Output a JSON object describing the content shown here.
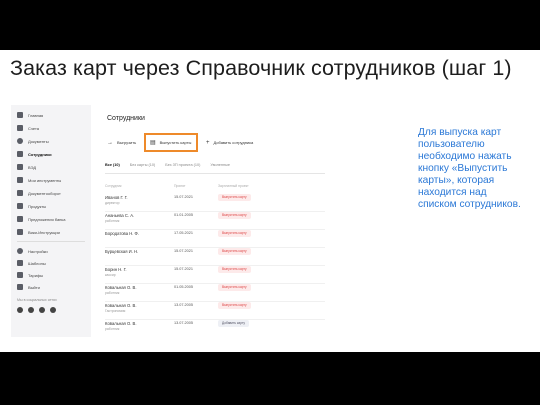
{
  "slide": {
    "title": "Заказ карт через Справочник сотрудников (шаг 1)",
    "note_lines": [
      "Для выпуска карт",
      "пользователю",
      "необходимо нажать",
      "кнопку «Выпустить",
      "карты», которая",
      "находится над",
      "списком сотрудников."
    ]
  },
  "app": {
    "sidebar": {
      "items": [
        {
          "label": "Главная",
          "icon": "home-icon"
        },
        {
          "label": "Счета",
          "icon": "wallet-icon"
        },
        {
          "label": "Документы",
          "icon": "document-icon"
        },
        {
          "label": "Сотрудники",
          "icon": "people-icon"
        },
        {
          "label": "ВЭД",
          "icon": "globe-icon"
        },
        {
          "label": "Мои инструменты",
          "icon": "tools-icon"
        },
        {
          "label": "Документооборот",
          "icon": "exchange-icon"
        },
        {
          "label": "Продукты",
          "icon": "box-icon"
        },
        {
          "label": "Предложения банка",
          "icon": "offer-icon"
        },
        {
          "label": "Вики-Инструкции",
          "icon": "book-icon"
        }
      ],
      "bottom_items": [
        {
          "label": "Настройки",
          "icon": "gear-icon"
        },
        {
          "label": "Шаблоны",
          "icon": "template-icon"
        },
        {
          "label": "Тарифы",
          "icon": "tariff-icon"
        },
        {
          "label": "Выйти",
          "icon": "logout-icon"
        }
      ],
      "social_label": "Мы в социальных сетях"
    },
    "main": {
      "title": "Сотрудники",
      "toolbar": {
        "upload_label": "Выгрузить",
        "issue_cards_label": "Выпустить карты",
        "add_employee_label": "Добавить сотрудника"
      },
      "tabs": [
        {
          "label": "Все (10)",
          "active": true
        },
        {
          "label": "Без карты (10)",
          "active": false
        },
        {
          "label": "Без ЗП проекта (10)",
          "active": false
        },
        {
          "label": "Уволенные",
          "active": false
        }
      ],
      "columns": [
        "Сотрудник",
        "Принят",
        "Зарплатный проект"
      ],
      "rows": [
        {
          "name": "Иванов Г. Г.",
          "role": "директор",
          "date": "15.07.2021",
          "status": "Выпустить карту",
          "status_kind": "red"
        },
        {
          "name": "Ананьева С. А.",
          "role": "работник",
          "date": "01.01.2005",
          "status": "Выпустить карту",
          "status_kind": "red"
        },
        {
          "name": "Бородатова Н. Ф.",
          "role": "",
          "date": "17.05.2021",
          "status": "Выпустить карту",
          "status_kind": "red"
        },
        {
          "name": "Бурцевская И. Н.",
          "role": "",
          "date": "15.07.2021",
          "status": "Выпустить карту",
          "status_kind": "red"
        },
        {
          "name": "Борин Н. Г.",
          "role": "кассир",
          "date": "15.07.2021",
          "status": "Выпустить карту",
          "status_kind": "red"
        },
        {
          "name": "Ковальная О. В.",
          "role": "работник",
          "date": "01.05.2005",
          "status": "Выпустить карту",
          "status_kind": "red"
        },
        {
          "name": "Ковальная О. В.",
          "role": "Гастрономия",
          "date": "13.07.2005",
          "status": "Выпустить карту",
          "status_kind": "red"
        },
        {
          "name": "Ковальная О. В.",
          "role": "работник",
          "date": "13.07.2005",
          "status": "Добавить карту",
          "status_kind": "grey"
        }
      ]
    }
  }
}
